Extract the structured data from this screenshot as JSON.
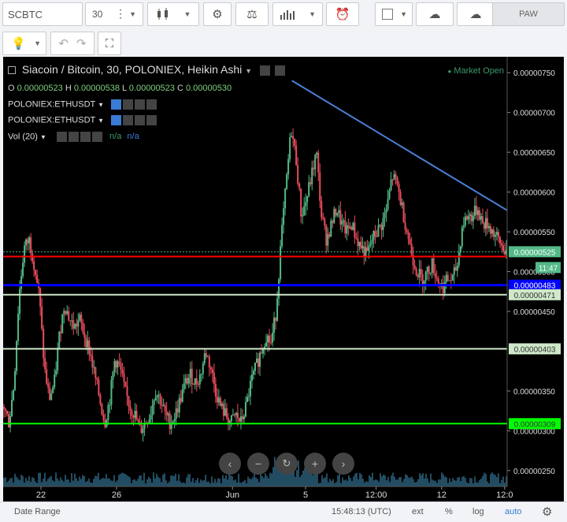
{
  "toolbar": {
    "symbol": "SCBTC",
    "interval": "30",
    "theme_label": "PAW",
    "icons": [
      "menu-dots-icon",
      "candles-icon",
      "gear-icon",
      "scales-icon",
      "indicators-icon",
      "alarm-clock-icon",
      "rect-icon",
      "cloud-download-icon",
      "cloud-upload-icon",
      "bulb-icon",
      "undo-icon",
      "redo-icon",
      "fullscreen-icon"
    ]
  },
  "legend": {
    "title": "Siacoin / Bitcoin, 30, POLONIEX, Heikin Ashi",
    "market_status": "Market Open",
    "ohlc": {
      "o_label": "O",
      "o": "0.00000523",
      "h_label": "H",
      "h": "0.00000538",
      "l_label": "L",
      "l": "0.00000523",
      "c_label": "C",
      "c": "0.00000530"
    },
    "studies": [
      "POLONIEX:ETHUSDT",
      "POLONIEX:ETHUSDT"
    ],
    "vol_label": "Vol (20)",
    "vol_na1": "n/a",
    "vol_na2": "n/a"
  },
  "colors": {
    "background": "#000000",
    "candle_up": "#53b987",
    "candle_down": "#eb4d5c",
    "trendline": "#4a7fd6",
    "line_red": "#ff0000",
    "line_blue": "#0000ff",
    "line_green": "#00ff00",
    "line_pale": "#cfe8c9",
    "volume": "#2a5f7a"
  },
  "chart_data": {
    "type": "candlestick",
    "ylim": [
      2.3e-06,
      7.7e-06
    ],
    "y_ticks": [
      "0.00000750",
      "0.00000700",
      "0.00000650",
      "0.00000600",
      "0.00000550",
      "0.00000500",
      "0.00000450",
      "0.00000350",
      "0.00000300",
      "0.00000250"
    ],
    "x_ticks": [
      "22",
      "26",
      "Jun",
      "5",
      "12:00",
      "12",
      "12:0"
    ],
    "price_tags": [
      {
        "value": "0.00000525",
        "bg": "#53b987",
        "fg": "#ffffff"
      },
      {
        "value": "11:47",
        "bg": "#53b987",
        "fg": "#ffffff"
      },
      {
        "value": "0.00000483",
        "bg": "#0000ff",
        "fg": "#ffffff"
      },
      {
        "value": "0.00000471",
        "bg": "#cfe8c9",
        "fg": "#333333"
      },
      {
        "value": "0.00000403",
        "bg": "#cfe8c9",
        "fg": "#333333"
      },
      {
        "value": "0.00000309",
        "bg": "#00ff00",
        "fg": "#333333"
      }
    ],
    "hlines": [
      {
        "y": 5.19e-06,
        "color": "#ff0000",
        "width": 2
      },
      {
        "y": 4.83e-06,
        "color": "#0000ff",
        "width": 3
      },
      {
        "y": 4.71e-06,
        "color": "#cfe8c9",
        "width": 2
      },
      {
        "y": 4.03e-06,
        "color": "#cfe8c9",
        "width": 2
      },
      {
        "y": 3.09e-06,
        "color": "#00ff00",
        "width": 2
      },
      {
        "y": 5.25e-06,
        "color": "#53b987",
        "width": 1,
        "dotted": true
      }
    ],
    "trendline": {
      "from": {
        "t": 0.573,
        "y": 7.4e-06
      },
      "to": {
        "t": 1.0,
        "y": 5.77e-06
      }
    },
    "path": [
      [
        0.0,
        3.3e-06
      ],
      [
        0.01,
        3.1e-06
      ],
      [
        0.02,
        3.6e-06
      ],
      [
        0.03,
        4.7e-06
      ],
      [
        0.04,
        5.3e-06
      ],
      [
        0.05,
        5.4e-06
      ],
      [
        0.06,
        5.1e-06
      ],
      [
        0.07,
        4.7e-06
      ],
      [
        0.08,
        3.8e-06
      ],
      [
        0.09,
        3.4e-06
      ],
      [
        0.1,
        3.6e-06
      ],
      [
        0.11,
        4.2e-06
      ],
      [
        0.12,
        4.6e-06
      ],
      [
        0.13,
        4.4e-06
      ],
      [
        0.14,
        4.3e-06
      ],
      [
        0.15,
        4.4e-06
      ],
      [
        0.16,
        4.2e-06
      ],
      [
        0.17,
        4e-06
      ],
      [
        0.18,
        3.7e-06
      ],
      [
        0.19,
        3.4e-06
      ],
      [
        0.2,
        3.1e-06
      ],
      [
        0.21,
        3.4e-06
      ],
      [
        0.22,
        3.9e-06
      ],
      [
        0.23,
        3.8e-06
      ],
      [
        0.24,
        3.5e-06
      ],
      [
        0.25,
        3.3e-06
      ],
      [
        0.26,
        3.2e-06
      ],
      [
        0.27,
        3e-06
      ],
      [
        0.28,
        3.1e-06
      ],
      [
        0.29,
        3.2e-06
      ],
      [
        0.3,
        3.5e-06
      ],
      [
        0.31,
        3.4e-06
      ],
      [
        0.32,
        3.2e-06
      ],
      [
        0.33,
        3.1e-06
      ],
      [
        0.34,
        3.2e-06
      ],
      [
        0.35,
        3.4e-06
      ],
      [
        0.36,
        3.6e-06
      ],
      [
        0.37,
        3.7e-06
      ],
      [
        0.38,
        3.6e-06
      ],
      [
        0.39,
        3.7e-06
      ],
      [
        0.4,
        4e-06
      ],
      [
        0.41,
        3.8e-06
      ],
      [
        0.42,
        3.5e-06
      ],
      [
        0.43,
        3.3e-06
      ],
      [
        0.44,
        3.2e-06
      ],
      [
        0.45,
        3.1e-06
      ],
      [
        0.46,
        3.2e-06
      ],
      [
        0.47,
        3.1e-06
      ],
      [
        0.48,
        3.3e-06
      ],
      [
        0.49,
        3.6e-06
      ],
      [
        0.5,
        3.8e-06
      ],
      [
        0.51,
        4e-06
      ],
      [
        0.52,
        4.2e-06
      ],
      [
        0.53,
        4.1e-06
      ],
      [
        0.54,
        4.5e-06
      ],
      [
        0.55,
        5.4e-06
      ],
      [
        0.56,
        6.1e-06
      ],
      [
        0.57,
        6.8e-06
      ],
      [
        0.58,
        6.4e-06
      ],
      [
        0.59,
        5.7e-06
      ],
      [
        0.6,
        5.9e-06
      ],
      [
        0.61,
        6.2e-06
      ],
      [
        0.62,
        6.5e-06
      ],
      [
        0.63,
        5.7e-06
      ],
      [
        0.64,
        5.4e-06
      ],
      [
        0.65,
        5.6e-06
      ],
      [
        0.66,
        5.8e-06
      ],
      [
        0.67,
        5.6e-06
      ],
      [
        0.68,
        5.5e-06
      ],
      [
        0.69,
        5.6e-06
      ],
      [
        0.7,
        5.4e-06
      ],
      [
        0.71,
        5.3e-06
      ],
      [
        0.72,
        5.2e-06
      ],
      [
        0.73,
        5.4e-06
      ],
      [
        0.74,
        5.5e-06
      ],
      [
        0.75,
        5.6e-06
      ],
      [
        0.76,
        5.8e-06
      ],
      [
        0.77,
        6.2e-06
      ],
      [
        0.78,
        6.1e-06
      ],
      [
        0.79,
        5.8e-06
      ],
      [
        0.8,
        5.5e-06
      ],
      [
        0.81,
        5.2e-06
      ],
      [
        0.82,
        5e-06
      ],
      [
        0.83,
        4.9e-06
      ],
      [
        0.84,
        5e-06
      ],
      [
        0.85,
        5.1e-06
      ],
      [
        0.86,
        4.9e-06
      ],
      [
        0.87,
        4.8e-06
      ],
      [
        0.88,
        4.9e-06
      ],
      [
        0.89,
        4.9e-06
      ],
      [
        0.9,
        5.1e-06
      ],
      [
        0.91,
        5.6e-06
      ],
      [
        0.92,
        5.7e-06
      ],
      [
        0.93,
        5.7e-06
      ],
      [
        0.94,
        5.8e-06
      ],
      [
        0.95,
        5.6e-06
      ],
      [
        0.96,
        5.6e-06
      ],
      [
        0.97,
        5.5e-06
      ],
      [
        0.98,
        5.4e-06
      ],
      [
        0.99,
        5.3e-06
      ],
      [
        1.0,
        5.25e-06
      ]
    ]
  },
  "zoom_controls": [
    "chevron-left-icon",
    "minus-icon",
    "reset-icon",
    "plus-icon",
    "chevron-right-icon"
  ],
  "bottom_bar": {
    "date_range": "Date Range",
    "time": "15:48:13 (UTC)",
    "ext": "ext",
    "percent": "%",
    "log": "log",
    "auto": "auto"
  }
}
